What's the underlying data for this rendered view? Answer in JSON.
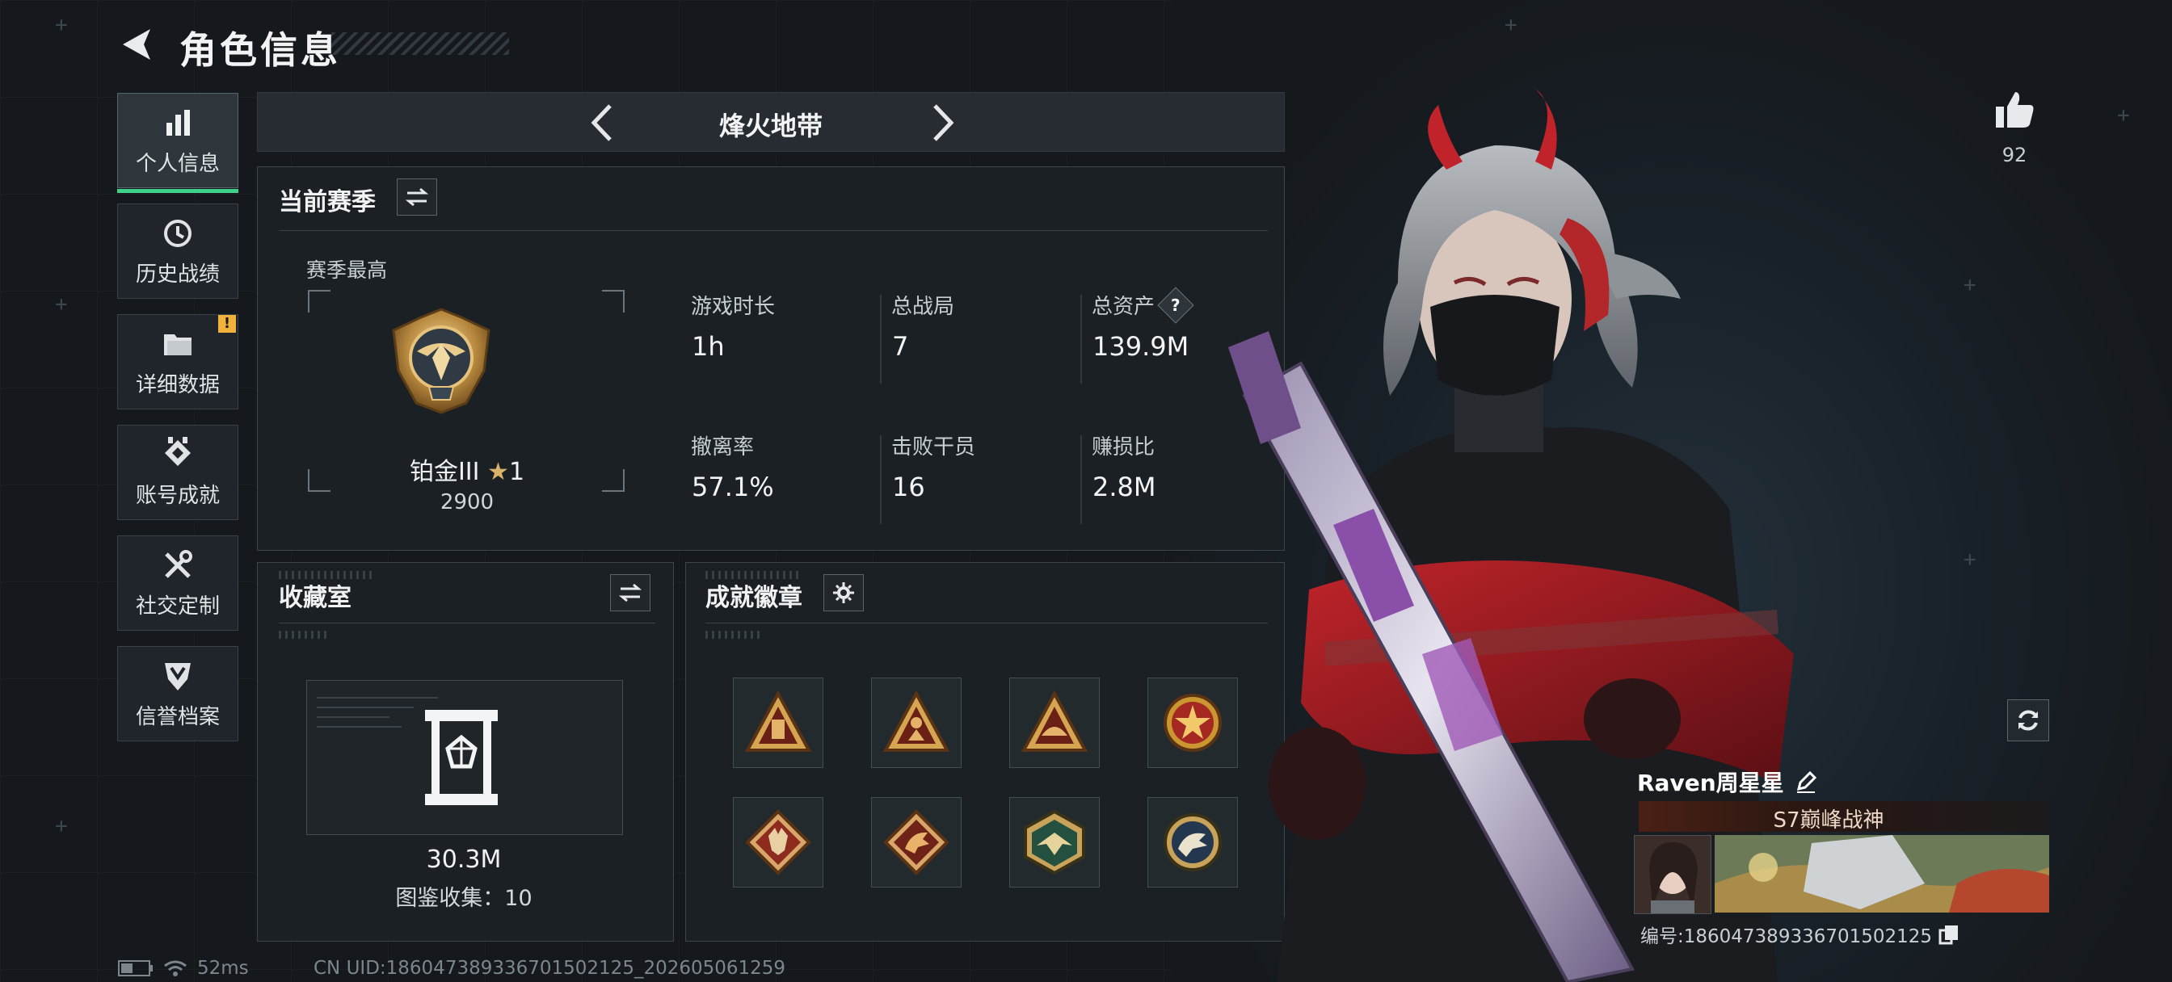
{
  "header": {
    "title": "角色信息"
  },
  "sidebar": {
    "items": [
      {
        "label": "个人信息",
        "icon": "bar-chart-icon",
        "active": true
      },
      {
        "label": "历史战绩",
        "icon": "clock-icon"
      },
      {
        "label": "详细数据",
        "icon": "folder-icon",
        "badge": "!"
      },
      {
        "label": "账号成就",
        "icon": "medal-icon"
      },
      {
        "label": "社交定制",
        "icon": "tools-icon"
      },
      {
        "label": "信誉档案",
        "icon": "shield-icon"
      }
    ]
  },
  "mode": {
    "title": "烽火地带"
  },
  "season": {
    "title": "当前赛季",
    "subtitle": "赛季最高",
    "rank": "铂金III",
    "stars": "1",
    "score": "2900",
    "stats": [
      {
        "label": "游戏时长",
        "value": "1h"
      },
      {
        "label": "总战局",
        "value": "7"
      },
      {
        "label": "总资产",
        "value": "139.9M",
        "help": "?"
      },
      {
        "label": "撤离率",
        "value": "57.1%"
      },
      {
        "label": "击败干员",
        "value": "16"
      },
      {
        "label": "赚损比",
        "value": "2.8M"
      }
    ]
  },
  "collection": {
    "title": "收藏室",
    "value": "30.3M",
    "count": "图鉴收集：10"
  },
  "badges": {
    "title": "成就徽章"
  },
  "likes": {
    "count": "92"
  },
  "profile": {
    "name": "Raven周星星",
    "title": "S7巅峰战神",
    "uid": "编号:1860473893367015021​25"
  },
  "status": {
    "ping": "52ms",
    "cn_uid": "CN UID:186047389336701502125_202605061259"
  },
  "colors": {
    "accent": "#3fd08a",
    "warning": "#f0b23a",
    "panel_bg": "#1b2024"
  }
}
